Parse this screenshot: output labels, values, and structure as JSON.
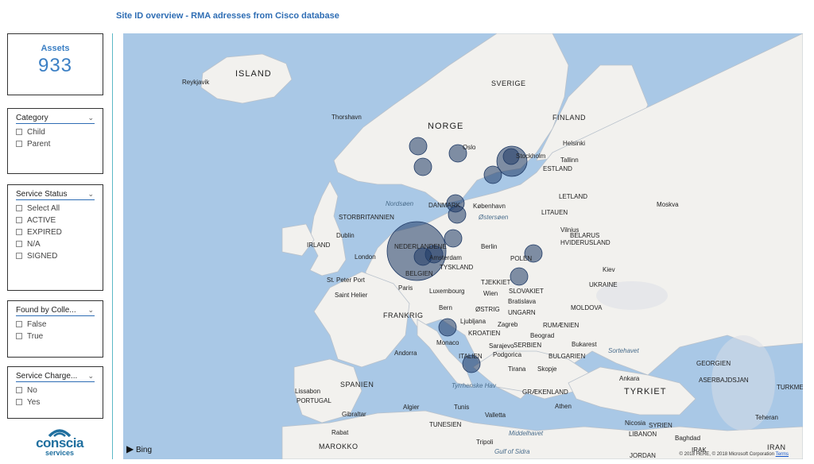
{
  "report": {
    "title": "Site ID overview - RMA adresses from Cisco database"
  },
  "card": {
    "label": "Assets",
    "value": "933"
  },
  "slicers": {
    "category": {
      "title": "Category",
      "options": [
        "Child",
        "Parent"
      ]
    },
    "service_status": {
      "title": "Service Status",
      "options": [
        "Select All",
        "ACTIVE",
        "EXPIRED",
        "N/A",
        "SIGNED"
      ]
    },
    "found_by": {
      "title": "Found by Colle...",
      "options": [
        "False",
        "True"
      ]
    },
    "service_charge": {
      "title": "Service Charge...",
      "options": [
        "No",
        "Yes"
      ]
    }
  },
  "logo": {
    "name": "conscia",
    "sub": "services"
  },
  "map": {
    "provider": "Bing",
    "attribution": "© 2018 HERE, © 2018 Microsoft Corporation",
    "terms": "Terms",
    "labels": [
      "ISLAND",
      "Reykjavik",
      "SVERIGE",
      "NORGE",
      "FINLAND",
      "Thorshavn",
      "Helsinki",
      "Tallinn",
      "ESTLAND",
      "Stockholm",
      "Oslo",
      "Nordsøen",
      "DANMARK",
      "København",
      "Østersøen",
      "LETLAND",
      "LITAUEN",
      "Vilnius",
      "Moskva",
      "STORBRITANNIEN",
      "BELARUS",
      "HVIDERUSLAND",
      "Dublin",
      "IRLAND",
      "London",
      "Berlin",
      "POLEN",
      "Kiev",
      "UKRAINE",
      "NEDERLANDENE",
      "Amsterdam",
      "TYSKLAND",
      "BELGIEN",
      "St. Peter Port",
      "Saint Helier",
      "Paris",
      "Luxembourg",
      "TJEKKIET",
      "SLOVAKIET",
      "Wien",
      "Bratislava",
      "MOLDOVA",
      "FRANKRIG",
      "Bern",
      "ØSTRIG",
      "UNGARN",
      "Ljubljana",
      "Zagreb",
      "RUMÆNIEN",
      "Beograd",
      "KROATIEN",
      "SERBIEN",
      "Bukarest",
      "Monaco",
      "Sarajevo",
      "Podgorica",
      "BULGARIEN",
      "Andorra",
      "ITALIEN",
      "Tirana",
      "Skopje",
      "Sortehavet",
      "GEORGIEN",
      "Ankara",
      "ASERBAJDSJAN",
      "SPANIEN",
      "Lissabon",
      "PORTUGAL",
      "Tyrrhenske Hav",
      "GRÆKENLAND",
      "TYRKIET",
      "TURKMENISTAN",
      "Athen",
      "Gibraltar",
      "Algier",
      "Tunis",
      "Valletta",
      "Nicosia",
      "SYRIEN",
      "Teheran",
      "TUNESIEN",
      "LIBANON",
      "Baghdad",
      "Rabat",
      "Middelhavet",
      "Tripoli",
      "MAROKKO",
      "Gulf of Sidra",
      "IRAK",
      "JORDAN",
      "IRAN"
    ],
    "bubbles_count": 16
  },
  "colors": {
    "accent": "#2e6db4",
    "divider": "#5bb8c7",
    "sea": "#a9c8e6",
    "land": "#f2f1ee",
    "bubble": "#1f3a66"
  }
}
